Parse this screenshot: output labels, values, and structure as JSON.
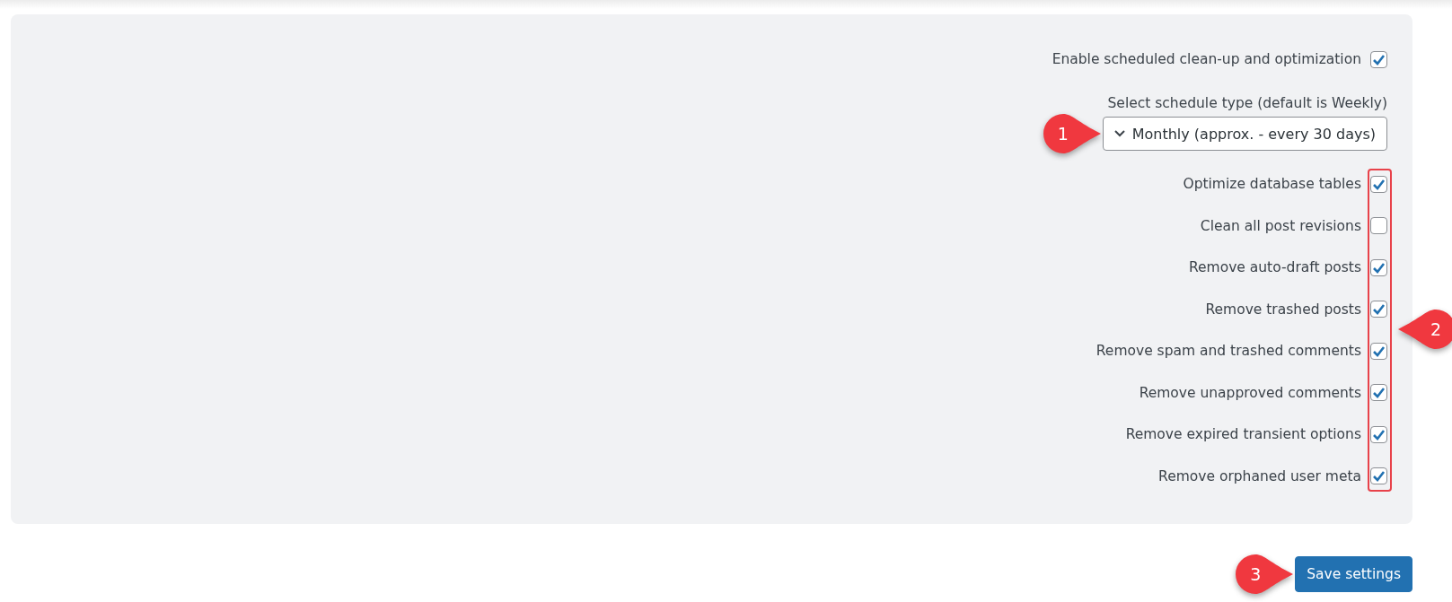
{
  "settings": {
    "enable": {
      "label": "Enable scheduled clean-up and optimization",
      "checked": true
    },
    "schedule": {
      "label": "Select schedule type (default is Weekly)",
      "value": "Monthly (approx. - every 30 days)",
      "callout": "1"
    },
    "options": [
      {
        "label": "Optimize database tables",
        "checked": true
      },
      {
        "label": "Clean all post revisions",
        "checked": false
      },
      {
        "label": "Remove auto-draft posts",
        "checked": true
      },
      {
        "label": "Remove trashed posts",
        "checked": true
      },
      {
        "label": "Remove spam and trashed comments",
        "checked": true
      },
      {
        "label": "Remove unapproved comments",
        "checked": true
      },
      {
        "label": "Remove expired transient options",
        "checked": true
      },
      {
        "label": "Remove orphaned user meta",
        "checked": true
      }
    ],
    "options_callout": "2"
  },
  "save": {
    "label": "Save settings",
    "callout": "3"
  }
}
